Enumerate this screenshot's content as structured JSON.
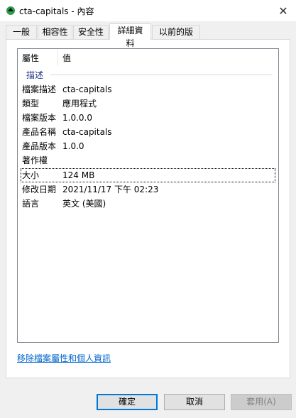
{
  "window": {
    "title": "cta-capitals - 內容",
    "close_glyph": "✕"
  },
  "tabs": [
    {
      "label": "一般"
    },
    {
      "label": "相容性"
    },
    {
      "label": "安全性"
    },
    {
      "label": "詳細資料"
    },
    {
      "label": "以前的版本"
    }
  ],
  "details": {
    "header_property": "屬性",
    "header_value": "值",
    "group_description": "描述",
    "rows": [
      {
        "k": "檔案描述",
        "v": "cta-capitals"
      },
      {
        "k": "類型",
        "v": "應用程式"
      },
      {
        "k": "檔案版本",
        "v": "1.0.0.0"
      },
      {
        "k": "產品名稱",
        "v": "cta-capitals"
      },
      {
        "k": "產品版本",
        "v": "1.0.0"
      },
      {
        "k": "著作權",
        "v": ""
      },
      {
        "k": "大小",
        "v": "124 MB"
      },
      {
        "k": "修改日期",
        "v": "2021/11/17 下午 02:23"
      },
      {
        "k": "語言",
        "v": "英文 (美國)"
      }
    ],
    "remove_link": "移除檔案屬性和個人資訊"
  },
  "buttons": {
    "ok": "確定",
    "cancel": "取消",
    "apply": "套用(A)"
  }
}
